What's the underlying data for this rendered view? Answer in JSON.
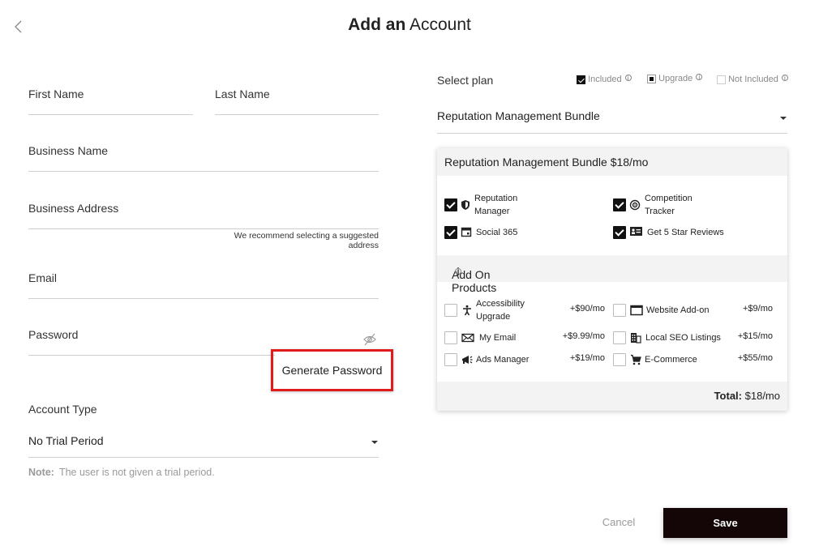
{
  "header": {
    "title_bold": "Add an",
    "title_rest": "Account"
  },
  "form": {
    "first_name_label": "First Name",
    "last_name_label": "Last Name",
    "business_name_label": "Business Name",
    "business_address_label": "Business Address",
    "address_hint": "We recommend selecting a suggested address",
    "email_label": "Email",
    "password_label": "Password",
    "generate_password_label": "Generate Password",
    "account_type_label": "Account Type",
    "account_type_value": "No Trial Period",
    "note_label": "Note:",
    "note_text": "The user is not given a trial period."
  },
  "plan": {
    "select_label": "Select plan",
    "legend": {
      "included": "Included",
      "upgrade": "Upgrade",
      "not_included": "Not Included"
    },
    "selected_plan": "Reputation Management Bundle",
    "bundle_title": "Reputation Management Bundle $18/mo",
    "included_items": [
      {
        "label": "Reputation Manager",
        "icon": "shield-icon"
      },
      {
        "label": "Competition Tracker",
        "icon": "target-icon"
      },
      {
        "label": "Social 365",
        "icon": "calendar-icon"
      },
      {
        "label": "Get 5 Star Reviews",
        "icon": "review-card-icon"
      }
    ],
    "addons_title": "Add On Products",
    "addons": [
      {
        "label": "Accessibility Upgrade",
        "price": "+$90/mo",
        "icon": "accessibility-icon"
      },
      {
        "label": "Website Add-on",
        "price": "+$9/mo",
        "icon": "browser-window-icon"
      },
      {
        "label": "My Email",
        "price": "+$9.99/mo",
        "icon": "envelope-icon"
      },
      {
        "label": "Local SEO Listings",
        "price": "+$15/mo",
        "icon": "building-icon"
      },
      {
        "label": "Ads Manager",
        "price": "+$19/mo",
        "icon": "megaphone-icon"
      },
      {
        "label": "E-Commerce",
        "price": "+$55/mo",
        "icon": "cart-icon"
      }
    ],
    "total_label": "Total:",
    "total_value": "$18/mo"
  },
  "actions": {
    "cancel": "Cancel",
    "save": "Save"
  }
}
